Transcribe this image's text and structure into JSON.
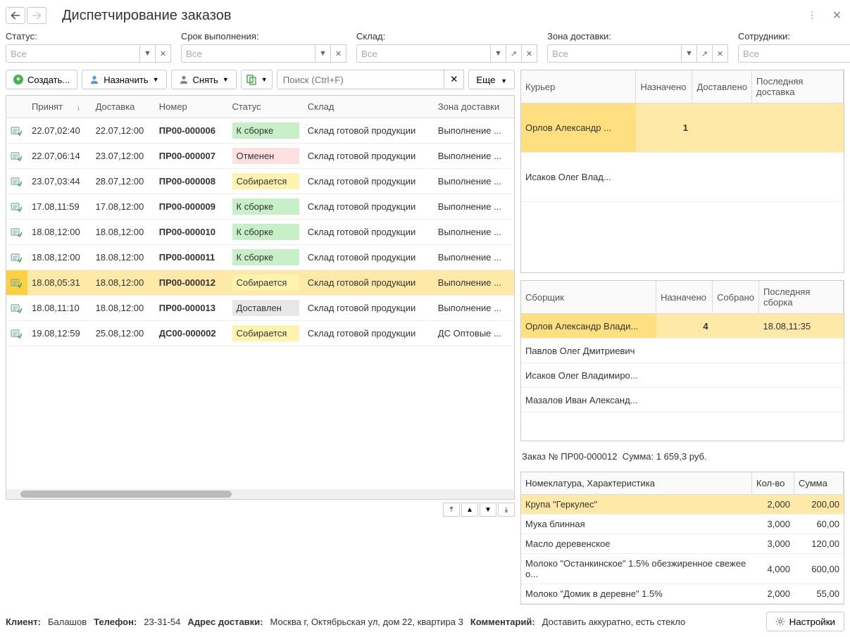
{
  "header": {
    "title": "Диспетчирование заказов"
  },
  "filters": {
    "status": {
      "label": "Статус:",
      "value": "Все"
    },
    "deadline": {
      "label": "Срок выполнения:",
      "value": "Все"
    },
    "warehouse": {
      "label": "Склад:",
      "value": "Все"
    },
    "zone": {
      "label": "Зона доставки:",
      "value": "Все"
    },
    "staff": {
      "label": "Сотрудники:",
      "value": "Все"
    }
  },
  "toolbar": {
    "create": "Создать...",
    "assign": "Назначить",
    "remove": "Снять",
    "more": "Еще",
    "search_placeholder": "Поиск (Ctrl+F)"
  },
  "orders": {
    "columns": {
      "accepted": "Принят",
      "delivery": "Доставка",
      "number": "Номер",
      "status": "Статус",
      "warehouse": "Склад",
      "zone": "Зона доставки"
    },
    "rows": [
      {
        "accepted": "22.07,02:40",
        "delivery": "22.07,12:00",
        "number": "ПР00-000006",
        "status": "К сборке",
        "status_cls": "status-green",
        "warehouse": "Склад готовой продукции",
        "zone": "Выполнение ..."
      },
      {
        "accepted": "22.07,06:14",
        "delivery": "23.07,12:00",
        "number": "ПР00-000007",
        "status": "Отменен",
        "status_cls": "status-pink",
        "warehouse": "Склад готовой продукции",
        "zone": "Выполнение ..."
      },
      {
        "accepted": "23.07,03:44",
        "delivery": "28.07,12:00",
        "number": "ПР00-000008",
        "status": "Собирается",
        "status_cls": "status-yellow",
        "warehouse": "Склад готовой продукции",
        "zone": "Выполнение ..."
      },
      {
        "accepted": "17.08,11:59",
        "delivery": "17.08,12:00",
        "number": "ПР00-000009",
        "status": "К сборке",
        "status_cls": "status-green",
        "warehouse": "Склад готовой продукции",
        "zone": "Выполнение ..."
      },
      {
        "accepted": "18.08,12:00",
        "delivery": "18.08,12:00",
        "number": "ПР00-000010",
        "status": "К сборке",
        "status_cls": "status-green",
        "warehouse": "Склад готовой продукции",
        "zone": "Выполнение ..."
      },
      {
        "accepted": "18.08,12:00",
        "delivery": "18.08,12:00",
        "number": "ПР00-000011",
        "status": "К сборке",
        "status_cls": "status-green",
        "warehouse": "Склад готовой продукции",
        "zone": "Выполнение ..."
      },
      {
        "accepted": "18.08,05:31",
        "delivery": "18.08,12:00",
        "number": "ПР00-000012",
        "status": "Собирается",
        "status_cls": "status-yellow",
        "warehouse": "Склад готовой продукции",
        "zone": "Выполнение ...",
        "selected": true
      },
      {
        "accepted": "18.08,11:10",
        "delivery": "18.08,12:00",
        "number": "ПР00-000013",
        "status": "Доставлен",
        "status_cls": "status-gray",
        "warehouse": "Склад готовой продукции",
        "zone": "Выполнение ..."
      },
      {
        "accepted": "19.08,12:59",
        "delivery": "25.08,12:00",
        "number": "ДС00-000002",
        "status": "Собирается",
        "status_cls": "status-yellow",
        "warehouse": "Склад готовой продукции",
        "zone": "ДС Оптовые ..."
      }
    ]
  },
  "couriers": {
    "columns": {
      "name": "Курьер",
      "assigned": "Назначено",
      "delivered": "Доставлено",
      "last": "Последняя доставка"
    },
    "rows": [
      {
        "name": "Орлов Александр ...",
        "assigned": "1",
        "delivered": "",
        "last": "",
        "selected": true
      },
      {
        "name": "Исаков Олег Влад...",
        "assigned": "",
        "delivered": "",
        "last": ""
      }
    ]
  },
  "pickers": {
    "columns": {
      "name": "Сборщик",
      "assigned": "Назначено",
      "picked": "Собрано",
      "last": "Последняя сборка"
    },
    "rows": [
      {
        "name": "Орлов Александр Влади...",
        "assigned": "4",
        "picked": "",
        "last": "18.08,11:35",
        "selected": true
      },
      {
        "name": "Павлов Олег Дмитриевич",
        "assigned": "",
        "picked": "",
        "last": ""
      },
      {
        "name": "Исаков Олег Владимиро...",
        "assigned": "",
        "picked": "",
        "last": ""
      },
      {
        "name": "Мазалов Иван Александ...",
        "assigned": "",
        "picked": "",
        "last": ""
      }
    ]
  },
  "order_summary": {
    "label1": "Заказ № ПР00-000012",
    "label2": "Сумма: 1 659,3 руб."
  },
  "items": {
    "columns": {
      "name": "Номеклатура, Характеристика",
      "qty": "Кол-во",
      "sum": "Сумма"
    },
    "rows": [
      {
        "name": "Крупа \"Геркулес\"",
        "qty": "2,000",
        "sum": "200,00",
        "selected": true
      },
      {
        "name": "Мука блинная",
        "qty": "3,000",
        "sum": "60,00"
      },
      {
        "name": "Масло деревенское",
        "qty": "3,000",
        "sum": "120,00"
      },
      {
        "name": "Молоко \"Останкинское\" 1.5% обезжиренное свежее о...",
        "qty": "4,000",
        "sum": "600,00"
      },
      {
        "name": "Молоко \"Домик в деревне\" 1.5%",
        "qty": "2,000",
        "sum": "55,00"
      }
    ]
  },
  "footer": {
    "client_lbl": "Клиент:",
    "client": "Балашов",
    "phone_lbl": "Телефон:",
    "phone": "23-31-54",
    "addr_lbl": "Адрес доставки:",
    "addr": "Москва г, Октябрьская ул, дом 22, квартира 3",
    "comment_lbl": "Комментарий:",
    "comment": "Доставить аккуратно, есть стекло",
    "settings": "Настройки"
  }
}
